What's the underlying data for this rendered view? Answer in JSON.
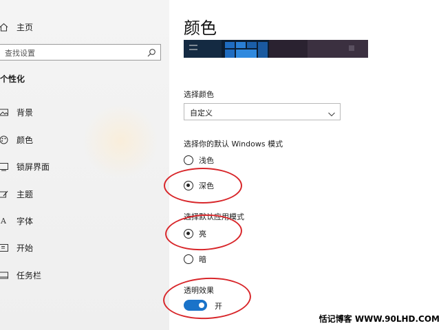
{
  "sidebar": {
    "home_label": "主页",
    "search_placeholder": "查找设置",
    "section_title": "个性化",
    "items": [
      {
        "label": "背景",
        "icon": "picture-icon"
      },
      {
        "label": "颜色",
        "icon": "palette-icon"
      },
      {
        "label": "锁屏界面",
        "icon": "lock-screen-icon"
      },
      {
        "label": "主题",
        "icon": "brush-icon"
      },
      {
        "label": "字体",
        "icon": "font-icon"
      },
      {
        "label": "开始",
        "icon": "start-icon"
      },
      {
        "label": "任务栏",
        "icon": "taskbar-icon"
      }
    ]
  },
  "main": {
    "title": "颜色",
    "choose_color_label": "选择颜色",
    "choose_color_value": "自定义",
    "windows_mode_label": "选择你的默认 Windows 模式",
    "windows_mode_options": [
      {
        "label": "浅色",
        "selected": false
      },
      {
        "label": "深色",
        "selected": true
      }
    ],
    "app_mode_label": "选择默认应用模式",
    "app_mode_options": [
      {
        "label": "亮",
        "selected": true
      },
      {
        "label": "暗",
        "selected": false
      }
    ],
    "transparency_label": "透明效果",
    "transparency_state": "开"
  },
  "watermark": "恬记博客 WWW.90LHD.COM",
  "colors": {
    "accent": "#1a73c9",
    "annotation": "#d8262a",
    "preview_bg": "#0b1e33"
  }
}
